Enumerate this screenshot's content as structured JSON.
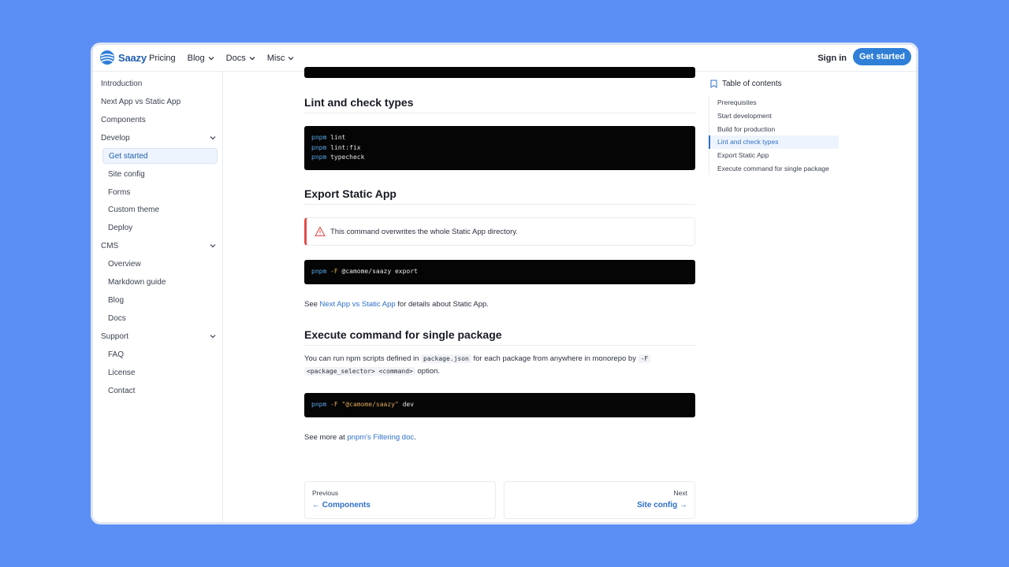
{
  "header": {
    "brand": "Saazy",
    "nav": [
      {
        "label": "Pricing",
        "dropdown": false
      },
      {
        "label": "Blog",
        "dropdown": true
      },
      {
        "label": "Docs",
        "dropdown": true
      },
      {
        "label": "Misc",
        "dropdown": true
      }
    ],
    "sign_in": "Sign in",
    "cta": "Get started"
  },
  "sidebar": {
    "items": [
      {
        "label": "Introduction"
      },
      {
        "label": "Next App vs Static App"
      },
      {
        "label": "Components"
      },
      {
        "label": "Develop",
        "section": true
      },
      {
        "label": "Get started",
        "active": true
      },
      {
        "label": "Site config"
      },
      {
        "label": "Forms"
      },
      {
        "label": "Custom theme"
      },
      {
        "label": "Deploy"
      },
      {
        "label": "CMS",
        "section": true
      },
      {
        "label": "Overview"
      },
      {
        "label": "Markdown guide"
      },
      {
        "label": "Blog"
      },
      {
        "label": "Docs"
      },
      {
        "label": "Support",
        "section": true
      },
      {
        "label": "FAQ"
      },
      {
        "label": "License"
      },
      {
        "label": "Contact"
      }
    ]
  },
  "content": {
    "lint": {
      "heading": "Lint and check types",
      "code": [
        {
          "cmd": "pnpm",
          "rest": " lint"
        },
        {
          "cmd": "pnpm",
          "rest": " lint:fix"
        },
        {
          "cmd": "pnpm",
          "rest": " typecheck"
        }
      ]
    },
    "export": {
      "heading": "Export Static App",
      "alert": "This command overwrites the whole Static App directory.",
      "code": {
        "cmd": "pnpm",
        "flag": " -F",
        "rest": " @camome/saazy export"
      },
      "see_prefix": "See ",
      "see_link": "Next App vs Static App",
      "see_suffix": " for details about Static App."
    },
    "execute": {
      "heading": "Execute command for single package",
      "para_1": "You can run npm scripts defined in ",
      "code_pkg": "package.json",
      "para_2": " for each package from anywhere in monorepo by ",
      "code_f": "-F",
      "code_sel": "<package_selector> <command>",
      "para_3": " option.",
      "code": {
        "cmd": "pnpm",
        "flag": " -F",
        "str": " \"@camome/saazy\"",
        "rest": " dev"
      },
      "more_prefix": "See more at ",
      "more_link": "pnpm's Filtering doc",
      "more_suffix": "."
    },
    "pager": {
      "prev_label": "Previous",
      "prev_title": "← Components",
      "next_label": "Next",
      "next_title": "Site config →"
    }
  },
  "toc": {
    "title": "Table of contents",
    "items": [
      {
        "label": "Prerequisites"
      },
      {
        "label": "Start development"
      },
      {
        "label": "Build for production"
      },
      {
        "label": "Lint and check types",
        "active": true
      },
      {
        "label": "Export Static App"
      },
      {
        "label": "Execute command for single package"
      }
    ]
  },
  "colors": {
    "background": "#5b8ff5",
    "accent": "#2f7fd8",
    "link": "#2e6fc7",
    "alert": "#e34b4b"
  }
}
